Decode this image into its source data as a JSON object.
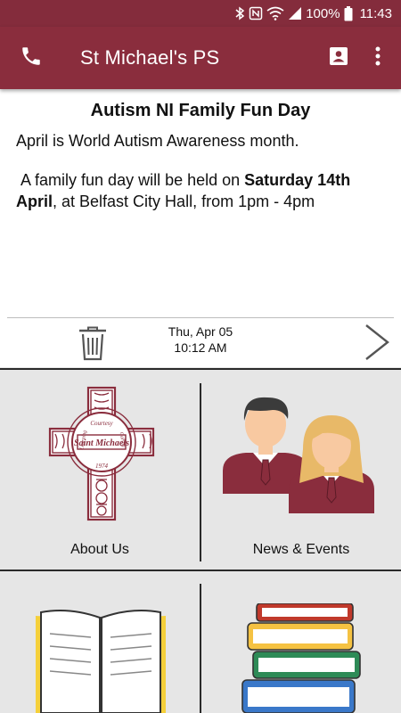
{
  "status_bar": {
    "battery": "100%",
    "time": "11:43"
  },
  "app_bar": {
    "title": "St Michael's PS"
  },
  "notice": {
    "headline": "Autism NI Family Fun Day",
    "paragraph1": "April is World Autism Awareness month.",
    "paragraph2_before": " A family fun day will be held on ",
    "paragraph2_bold": "Saturday 14th April",
    "paragraph2_after": ", at Belfast City Hall, from 1pm - 4pm",
    "date": "Thu, Apr 05",
    "time": "10:12 AM"
  },
  "menu": {
    "about": "About Us",
    "news": "News & Events"
  },
  "crest": {
    "top_text": "Courtesy",
    "left_text": "Learning",
    "right_text": "Caring",
    "center_text": "Saint Michaels",
    "year": "1974"
  },
  "colors": {
    "brand": "#8a2d3d",
    "status_bar": "#842c3c",
    "grid_background": "#e6e6e6"
  },
  "icons": {
    "phone": "phone-icon",
    "contact": "contact-card-icon",
    "more": "more-vertical-icon",
    "trash": "trash-icon",
    "next": "chevron-right-icon"
  }
}
